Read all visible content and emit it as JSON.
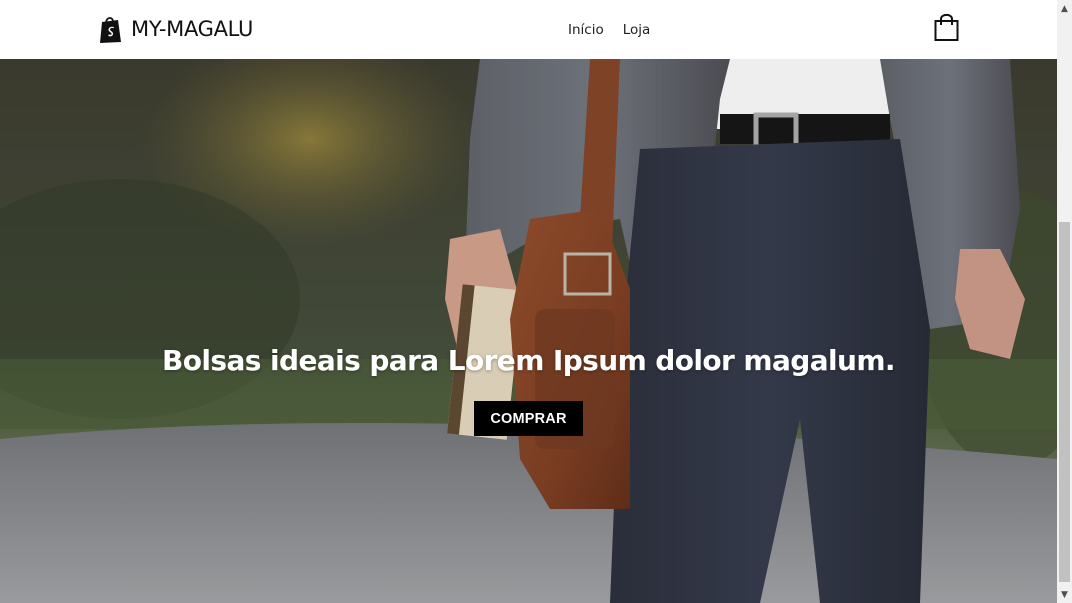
{
  "header": {
    "brand": "MY-MAGALU",
    "nav": [
      {
        "label": "Início"
      },
      {
        "label": "Loja"
      }
    ]
  },
  "hero": {
    "title": "Bolsas ideais para Lorem Ipsum dolor magalum.",
    "button_label": "COMPRAR",
    "image_description_icon": "hero-photo"
  },
  "scrollbar": {
    "up_arrow": "▲",
    "down_arrow": "▼"
  },
  "colors": {
    "header_bg": "#ffffff",
    "button_bg": "#000000",
    "button_text": "#ffffff",
    "title_text": "#ffffff"
  },
  "icons": [
    "shopify-bag-icon",
    "shopping-bag-icon"
  ]
}
